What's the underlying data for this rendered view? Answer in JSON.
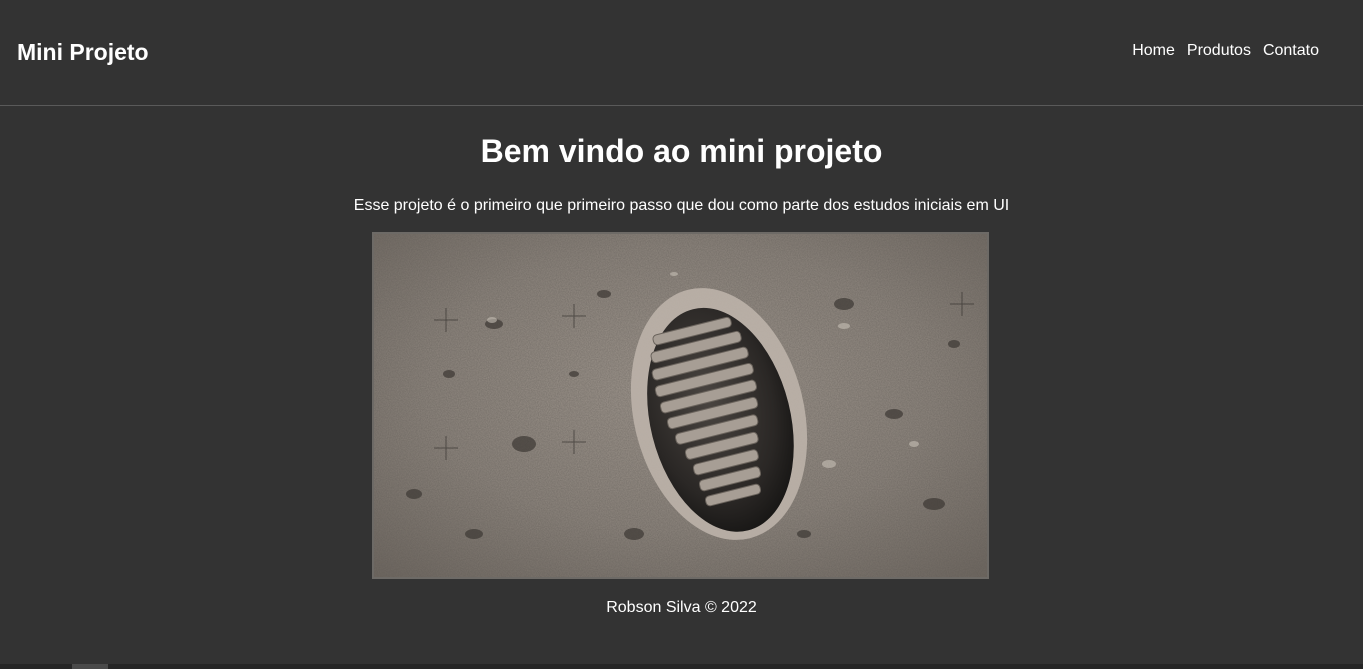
{
  "header": {
    "logo": "Mini Projeto",
    "nav": [
      {
        "label": "Home"
      },
      {
        "label": "Produtos"
      },
      {
        "label": "Contato"
      }
    ]
  },
  "main": {
    "title": "Bem vindo ao mini projeto",
    "intro": "Esse projeto é o primeiro que primeiro passo que dou como parte dos estudos iniciais em UI",
    "image_icon": "moon-footprint-photo"
  },
  "footer": {
    "text": "Robson Silva © 2022"
  },
  "colors": {
    "background": "#333333",
    "text": "#ffffff",
    "divider": "#5a5a5a"
  }
}
